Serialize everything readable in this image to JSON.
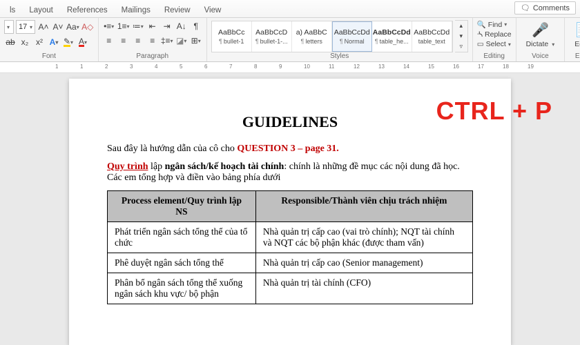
{
  "overlay_text": "CTRL + P",
  "tabs": {
    "t0": "ls",
    "t1": "Layout",
    "t2": "References",
    "t3": "Mailings",
    "t4": "Review",
    "t5": "View"
  },
  "comments_label": "Comments",
  "font": {
    "size": "17"
  },
  "group_labels": {
    "font": "Font",
    "paragraph": "Paragraph",
    "styles": "Styles",
    "editing": "Editing",
    "voice": "Voice",
    "editor": "Editor"
  },
  "styles": [
    {
      "sample": "AaBbCc",
      "name": "bullet-1"
    },
    {
      "sample": "AaBbCcD",
      "name": "bullet-1-..."
    },
    {
      "sample": "a) AaBbC",
      "name": "letters"
    },
    {
      "sample": "AaBbCcDd",
      "name": "Normal"
    },
    {
      "sample": "AaBbCcDd",
      "name": "table_he..."
    },
    {
      "sample": "AaBbCcDd",
      "name": "table_text"
    }
  ],
  "editing": {
    "find": "Find",
    "replace": "Replace",
    "select": "Select"
  },
  "voice": {
    "dictate": "Dictate"
  },
  "editor": {
    "label": "Editor"
  },
  "ruler_ticks": [
    "1",
    "1",
    "2",
    "3",
    "4",
    "5",
    "6",
    "7",
    "8",
    "9",
    "10",
    "11",
    "12",
    "13",
    "14",
    "15",
    "16",
    "17",
    "18",
    "19"
  ],
  "doc": {
    "title": "GUIDELINES",
    "intro_prefix": "Sau đây là hướng dẫn của cô cho ",
    "intro_highlight": "QUESTION 3 – page 31.",
    "p2_lead": "Quy trình",
    "p2_mid": " lập ",
    "p2_bold": "ngân sách/kế hoạch tài chính",
    "p2_rest": ": chính là những đề mục các nội dung đã học. Các em tổng hợp và điền vào bảng phía dưới",
    "th1": "Process element/Quy trình lập NS",
    "th2": "Responsible/Thành viên chịu trách nhiệm",
    "rows": [
      {
        "c1": "Phát triển ngân sách tổng thể của tổ chức",
        "c2": "Nhà quản trị cấp cao (vai trò chính); NQT tài chính và NQT các bộ phận khác (được tham vấn)"
      },
      {
        "c1": "Phê duyệt ngân sách tổng thể",
        "c2": "Nhà quản trị cấp cao (Senior management)"
      },
      {
        "c1": "Phân bổ ngân sách tổng thể xuống ngân sách khu vực/ bộ phận",
        "c2": "Nhà quản trị tài chính (CFO)"
      }
    ]
  }
}
